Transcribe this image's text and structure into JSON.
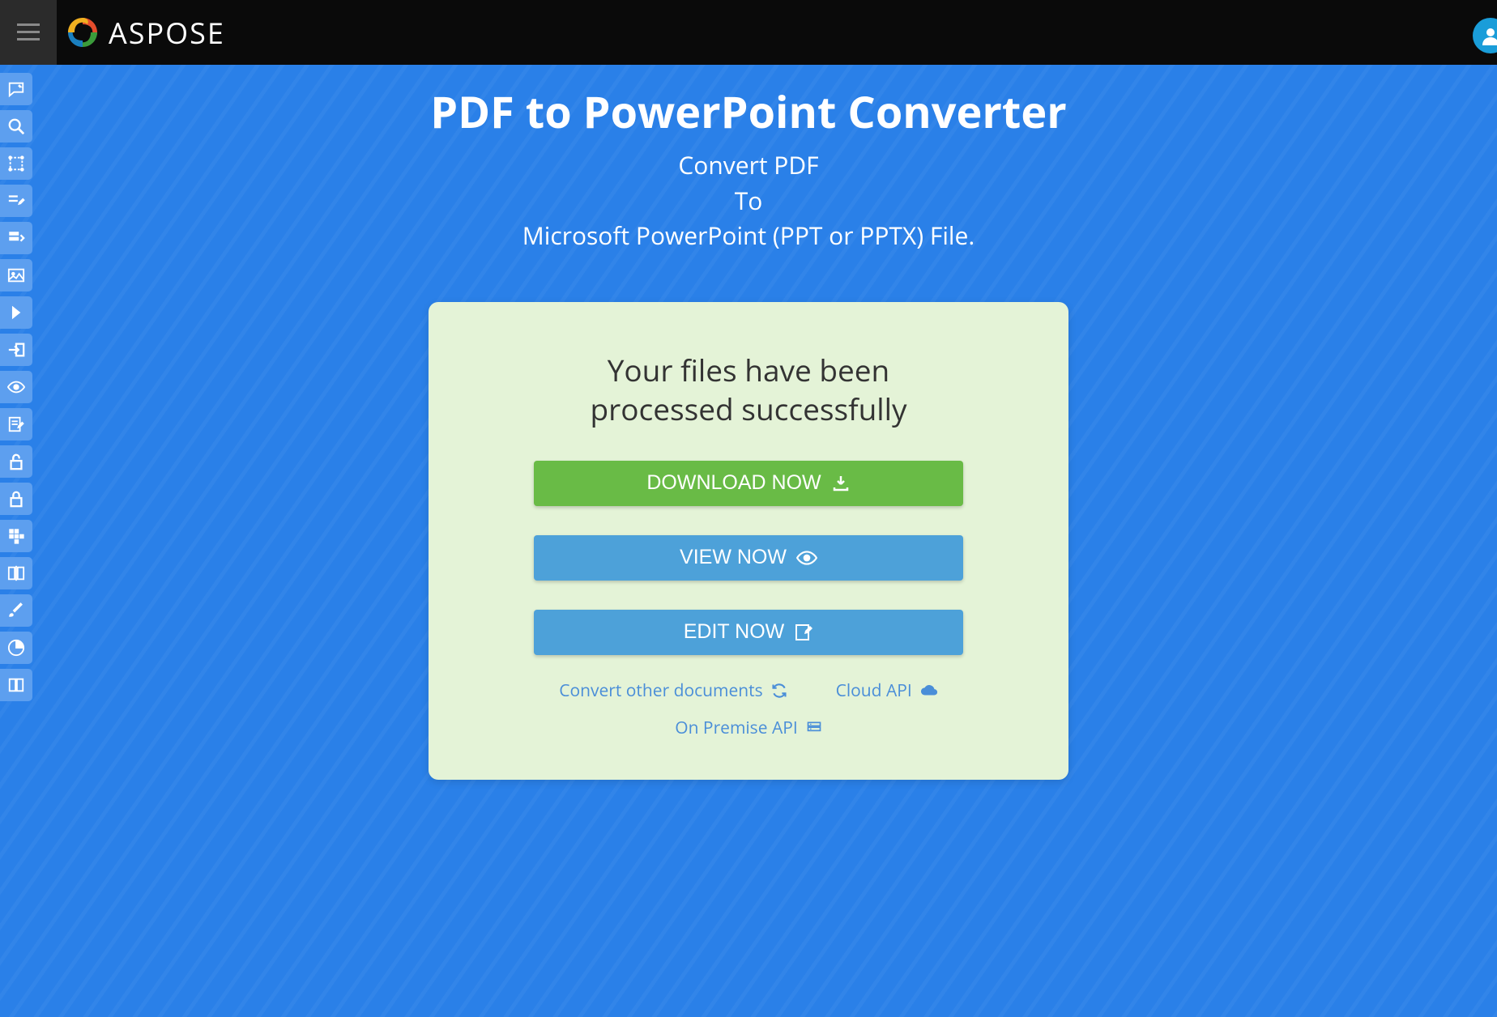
{
  "header": {
    "brand": "ASPOSE"
  },
  "hero": {
    "title": "PDF to PowerPoint Converter",
    "line1": "Convert PDF",
    "line2": "To",
    "line3": "Microsoft PowerPoint (PPT or PPTX) File."
  },
  "card": {
    "message": "Your files have been processed successfully",
    "download": "DOWNLOAD NOW",
    "view": "VIEW NOW",
    "edit": "EDIT NOW",
    "convert_other": "Convert other documents",
    "cloud_api": "Cloud API",
    "onpremise_api": "On Premise API"
  },
  "sidebar": {
    "items": [
      "comment-icon",
      "search-icon",
      "resize-icon",
      "edit-line-icon",
      "form-icon",
      "image-icon",
      "arrow-right-icon",
      "exit-icon",
      "eye-icon",
      "note-edit-icon",
      "unlock-icon",
      "lock-icon",
      "organize-icon",
      "compare-icon",
      "brush-icon",
      "chart-icon",
      "book-icon"
    ]
  }
}
